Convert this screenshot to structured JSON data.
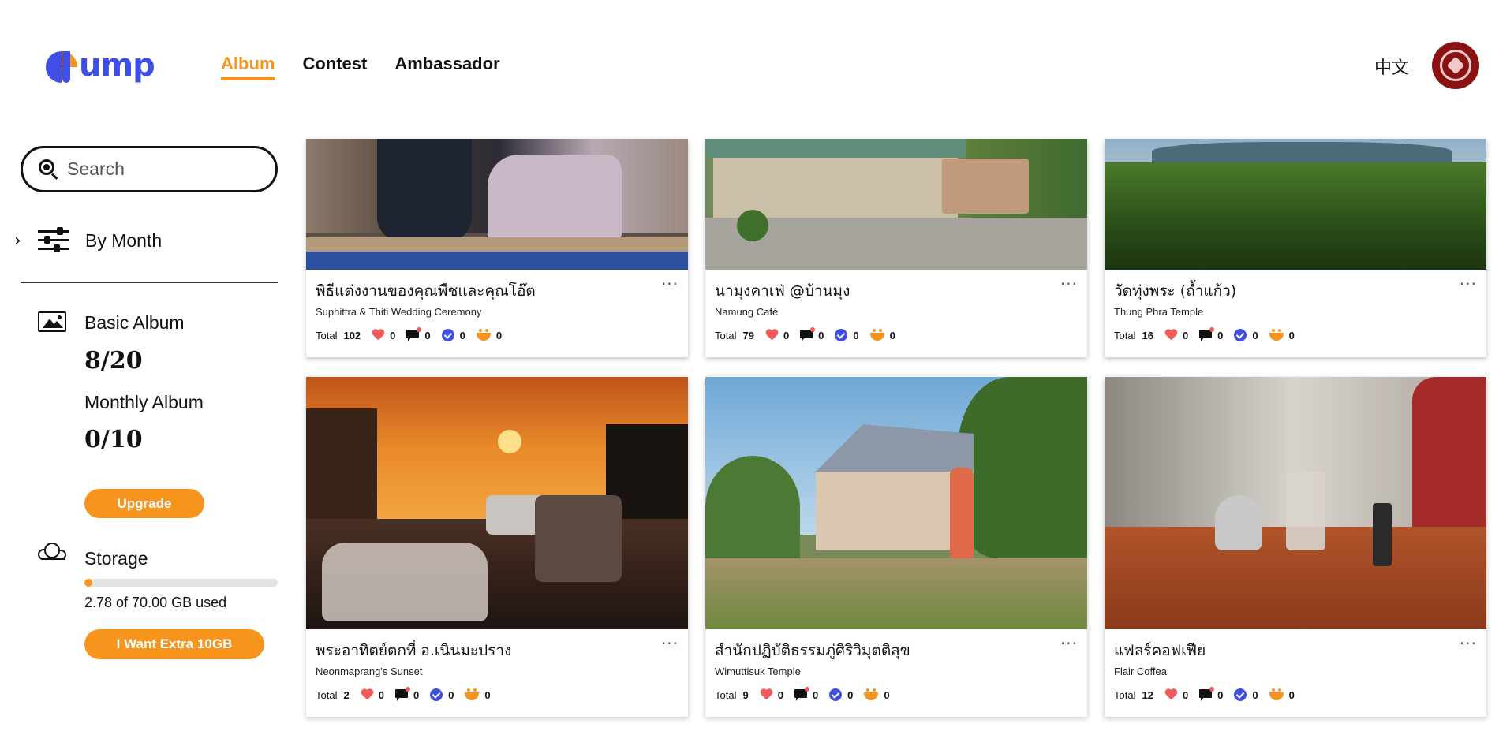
{
  "brand": {
    "logo_text": "ump"
  },
  "nav": [
    {
      "label": "Album",
      "active": true
    },
    {
      "label": "Contest",
      "active": false
    },
    {
      "label": "Ambassador",
      "active": false
    }
  ],
  "header": {
    "language": "中文"
  },
  "sidebar": {
    "search_placeholder": "Search",
    "filter_label": "By Month",
    "basic_album_label": "Basic Album",
    "basic_album_count": "8/20",
    "monthly_album_label": "Monthly Album",
    "monthly_album_count": "0/10",
    "upgrade_label": "Upgrade",
    "storage_label": "Storage",
    "storage_used_fraction": 0.0397,
    "storage_text": "2.78 of 70.00 GB used",
    "extra_label": "I Want Extra 10GB"
  },
  "stats_total_label": "Total",
  "more_label": "···",
  "albums": [
    {
      "title": "พิธีแต่งงานของคุณพืชและคุณโอ๊ต",
      "subtitle": "Suphittra & Thiti Wedding Ceremony",
      "total": "102",
      "likes": "0",
      "comments": "0",
      "verified": "0",
      "reactions": "0"
    },
    {
      "title": "นามุงคาเฟ่ @บ้านมุง",
      "subtitle": "Namung Café",
      "total": "79",
      "likes": "0",
      "comments": "0",
      "verified": "0",
      "reactions": "0"
    },
    {
      "title": "วัดทุ่งพระ (ถ้ำแก้ว)",
      "subtitle": "Thung Phra Temple",
      "total": "16",
      "likes": "0",
      "comments": "0",
      "verified": "0",
      "reactions": "0"
    },
    {
      "title": "พระอาทิตย์ตกที่ อ.เนินมะปราง",
      "subtitle": "Neonmaprang's Sunset",
      "total": "2",
      "likes": "0",
      "comments": "0",
      "verified": "0",
      "reactions": "0"
    },
    {
      "title": "สำนักปฏิบัติธรรมภู่ศิริวิมุตติสุข",
      "subtitle": "Wimuttisuk Temple",
      "total": "9",
      "likes": "0",
      "comments": "0",
      "verified": "0",
      "reactions": "0"
    },
    {
      "title": "แฟลร์คอฟเฟีย",
      "subtitle": "Flair Coffea",
      "total": "12",
      "likes": "0",
      "comments": "0",
      "verified": "0",
      "reactions": "0"
    }
  ]
}
